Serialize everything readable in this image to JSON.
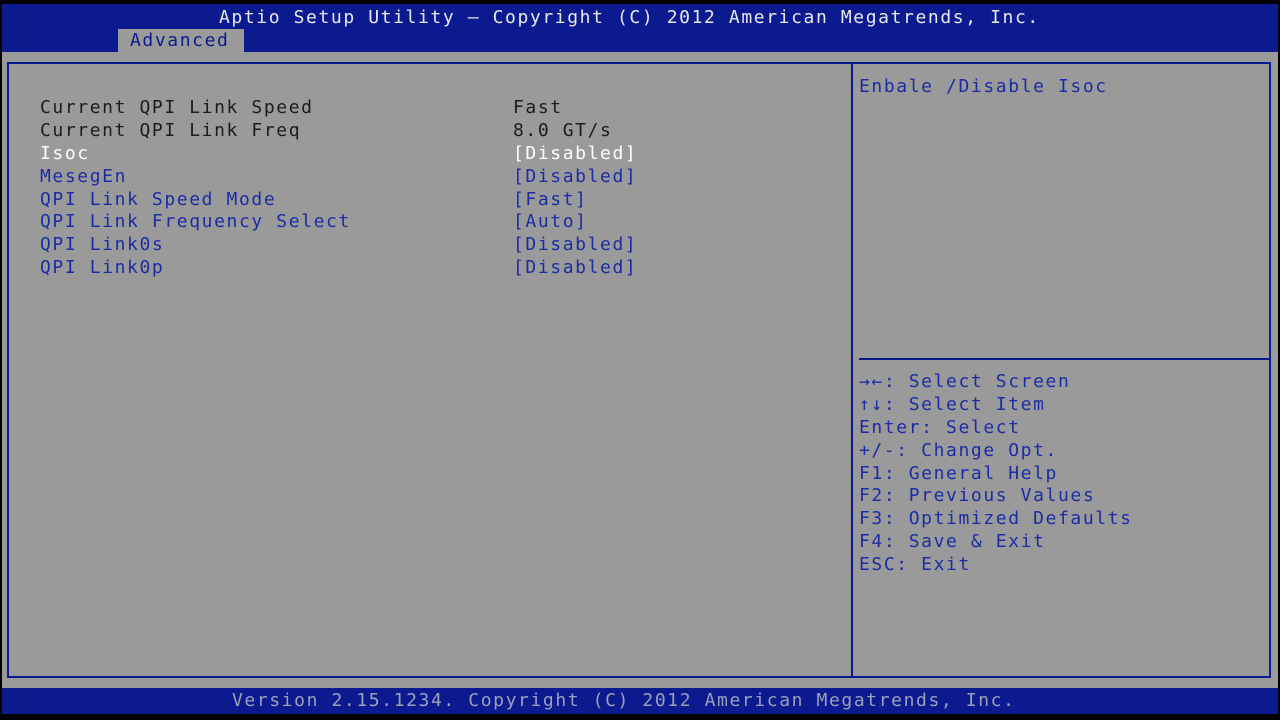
{
  "header": {
    "title": "Aptio Setup Utility – Copyright (C) 2012 American Megatrends, Inc.",
    "active_tab": "Advanced"
  },
  "settings": [
    {
      "label": "Current QPI Link Speed",
      "value": "Fast",
      "kind": "info"
    },
    {
      "label": "Current QPI Link Freq",
      "value": "8.0 GT/s",
      "kind": "info"
    },
    {
      "label": "Isoc",
      "value": "[Disabled]",
      "kind": "option",
      "selected": true
    },
    {
      "label": "MesegEn",
      "value": "[Disabled]",
      "kind": "option"
    },
    {
      "label": "QPI Link Speed Mode",
      "value": "[Fast]",
      "kind": "option"
    },
    {
      "label": "QPI Link Frequency Select",
      "value": "[Auto]",
      "kind": "option"
    },
    {
      "label": "QPI Link0s",
      "value": "[Disabled]",
      "kind": "option"
    },
    {
      "label": "QPI Link0p",
      "value": "[Disabled]",
      "kind": "option"
    }
  ],
  "help": {
    "text": "Enbale /Disable Isoc"
  },
  "keys": [
    "→←: Select Screen",
    "↑↓: Select Item",
    "Enter: Select",
    "+/-: Change Opt.",
    "F1: General Help",
    "F2: Previous Values",
    "F3: Optimized Defaults",
    "F4: Save & Exit",
    "ESC: Exit"
  ],
  "footer": {
    "text": "Version 2.15.1234. Copyright (C) 2012 American Megatrends, Inc."
  },
  "colors": {
    "bar": "#0c1a8f",
    "background": "#9a9a9a",
    "option_text": "#1c2ca5",
    "info_text": "#1c1c1c",
    "selected_text": "#ffffff"
  }
}
